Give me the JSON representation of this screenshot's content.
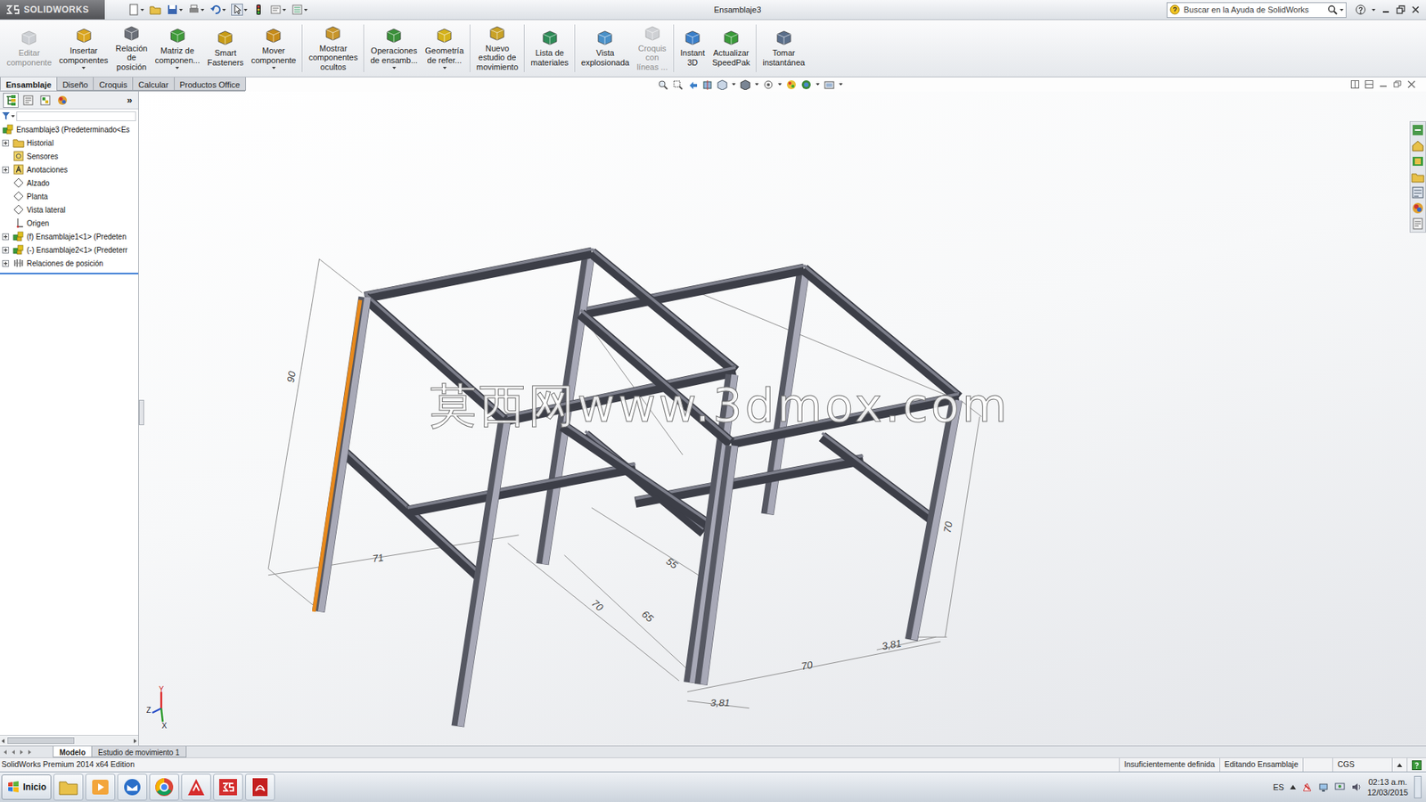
{
  "window": {
    "logo": "SOLIDWORKS",
    "title": "Ensamblaje3",
    "search": {
      "placeholder": "Buscar en la Ayuda de SolidWorks"
    }
  },
  "ribbon": [
    {
      "lines": [
        "Editar",
        "componente"
      ],
      "kind": "button",
      "disabled": true,
      "group": 1
    },
    {
      "lines": [
        "Insertar",
        "componentes"
      ],
      "kind": "split",
      "disabled": false,
      "group": 1
    },
    {
      "lines": [
        "Relación",
        "de",
        "posición"
      ],
      "kind": "button",
      "disabled": false,
      "group": 1
    },
    {
      "lines": [
        "Matriz de",
        "componen..."
      ],
      "kind": "split",
      "disabled": false,
      "group": 1
    },
    {
      "lines": [
        "Smart",
        "Fasteners"
      ],
      "kind": "button",
      "disabled": false,
      "group": 1
    },
    {
      "lines": [
        "Mover",
        "componente"
      ],
      "kind": "split",
      "disabled": false,
      "group": 1
    },
    {
      "lines": [
        "Mostrar",
        "componentes",
        "ocultos"
      ],
      "kind": "button",
      "disabled": false,
      "group": 2
    },
    {
      "lines": [
        "Operaciones",
        "de ensamb..."
      ],
      "kind": "split",
      "disabled": false,
      "group": 3
    },
    {
      "lines": [
        "Geometría",
        "de refer..."
      ],
      "kind": "split",
      "disabled": false,
      "group": 3
    },
    {
      "lines": [
        "Nuevo",
        "estudio de",
        "movimiento"
      ],
      "kind": "button",
      "disabled": false,
      "group": 4
    },
    {
      "lines": [
        "Lista de",
        "materiales"
      ],
      "kind": "button",
      "disabled": false,
      "group": 5
    },
    {
      "lines": [
        "Vista",
        "explosionada"
      ],
      "kind": "button",
      "disabled": false,
      "group": 6
    },
    {
      "lines": [
        "Croquis",
        "con",
        "líneas ..."
      ],
      "kind": "button",
      "disabled": true,
      "group": 6
    },
    {
      "lines": [
        "Instant",
        "3D"
      ],
      "kind": "button",
      "disabled": false,
      "group": 7
    },
    {
      "lines": [
        "Actualizar",
        "SpeedPak"
      ],
      "kind": "button",
      "disabled": false,
      "group": 7
    },
    {
      "lines": [
        "Tomar",
        "instantánea"
      ],
      "kind": "button",
      "disabled": false,
      "group": 8
    }
  ],
  "command_tabs": [
    {
      "label": "Ensamblaje",
      "selected": true
    },
    {
      "label": "Diseño",
      "selected": false
    },
    {
      "label": "Croquis",
      "selected": false
    },
    {
      "label": "Calcular",
      "selected": false
    },
    {
      "label": "Productos Office",
      "selected": false
    }
  ],
  "panel": {
    "tabs": [
      {
        "selected": true
      },
      {
        "selected": false
      },
      {
        "selected": false
      },
      {
        "selected": false
      }
    ],
    "more": "»"
  },
  "tree": [
    {
      "label": "Ensamblaje3  (Predeterminado<Es",
      "kind": "assembly",
      "depth": 0,
      "expandable": false,
      "expanded": true
    },
    {
      "label": "Historial",
      "kind": "folder",
      "depth": 1,
      "expandable": true,
      "expanded": false
    },
    {
      "label": "Sensores",
      "kind": "sensor",
      "depth": 1,
      "expandable": false,
      "expanded": false
    },
    {
      "label": "Anotaciones",
      "kind": "annotation",
      "depth": 1,
      "expandable": true,
      "expanded": false
    },
    {
      "label": "Alzado",
      "kind": "plane",
      "depth": 1,
      "expandable": false,
      "expanded": false
    },
    {
      "label": "Planta",
      "kind": "plane",
      "depth": 1,
      "expandable": false,
      "expanded": false
    },
    {
      "label": "Vista lateral",
      "kind": "plane",
      "depth": 1,
      "expandable": false,
      "expanded": false
    },
    {
      "label": "Origen",
      "kind": "origin",
      "depth": 1,
      "expandable": false,
      "expanded": false
    },
    {
      "label": "(f) Ensamblaje1<1> (Predeten",
      "kind": "assembly",
      "depth": 1,
      "expandable": true,
      "expanded": false
    },
    {
      "label": "(-) Ensamblaje2<1> (Predeterr",
      "kind": "assembly",
      "depth": 1,
      "expandable": true,
      "expanded": false
    },
    {
      "label": "Relaciones de posición",
      "kind": "mates",
      "depth": 1,
      "expandable": true,
      "expanded": false
    }
  ],
  "model": {
    "edge_selected": true,
    "dims": [
      "90",
      "71",
      "70",
      "65",
      "55",
      "70",
      "70",
      "3,81",
      "3,81"
    ],
    "triad": [
      "Y",
      "Z",
      "X"
    ]
  },
  "watermark": "莫西网www.3dmox.com",
  "model_tabs": [
    {
      "label": "Modelo",
      "selected": true
    },
    {
      "label": "Estudio de movimiento 1",
      "selected": false
    }
  ],
  "status_bar": {
    "edition": "SolidWorks Premium 2014 x64 Edition",
    "state": "Insuficientemente definida",
    "mode": "Editando Ensamblaje",
    "units": "CGS"
  },
  "taskbar": {
    "start": "Inicio",
    "apps": [
      {
        "kind": "folder"
      },
      {
        "kind": "media"
      },
      {
        "kind": "mail"
      },
      {
        "kind": "chrome"
      },
      {
        "kind": "autocad"
      },
      {
        "kind": "solidworks"
      },
      {
        "kind": "pdf"
      }
    ],
    "lang": "ES",
    "time": "02:13 a.m.",
    "date": "12/03/2015"
  }
}
